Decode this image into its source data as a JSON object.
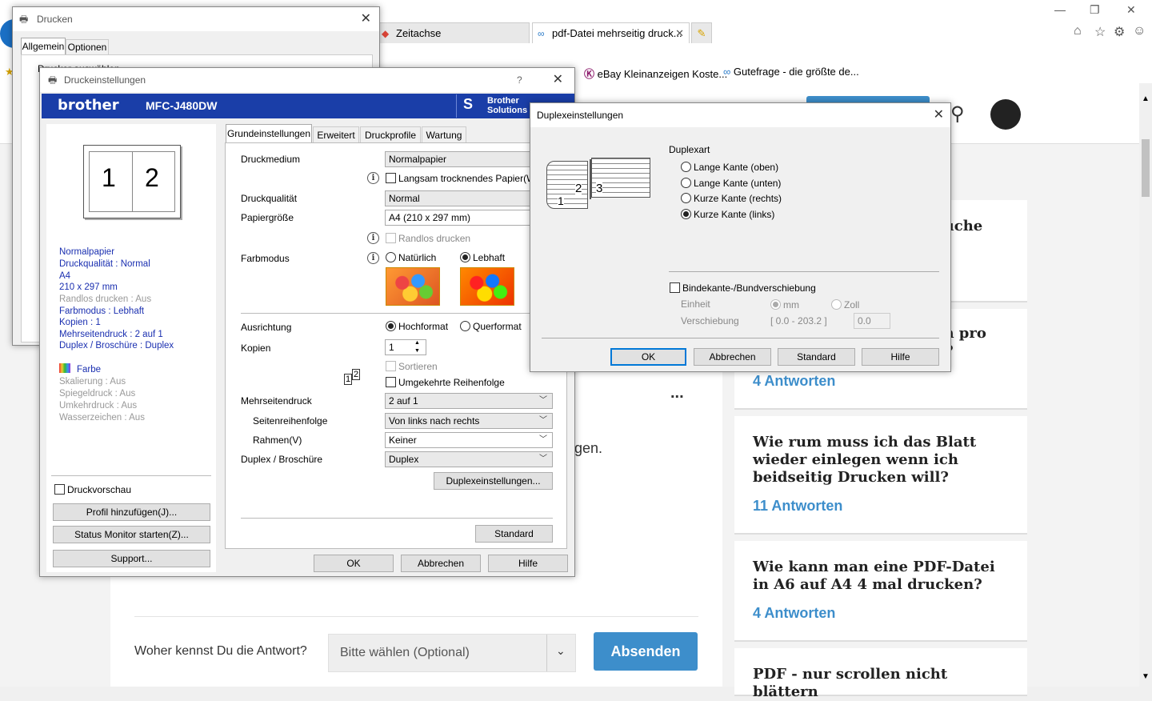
{
  "browser": {
    "tabs": [
      {
        "label": "Zeitachse"
      },
      {
        "label": "pdf-Datei mehrseitig druck..."
      }
    ],
    "window_controls": {
      "minimize": "—",
      "maximize": "❐",
      "close": "✕"
    },
    "favorites": [
      {
        "label": "eBay Kleinanzeigen  Koste..."
      },
      {
        "label": "Gutefrage - die größte de..."
      }
    ]
  },
  "site": {
    "main": {
      "partial_text": "gen.",
      "more": "...",
      "feedback_label": "Woher kennst Du die Antwort?",
      "select_placeholder": "Bitte wählen (Optional)",
      "submit_label": "Absenden"
    },
    "cards": [
      {
        "question": "auche",
        "answers": ""
      },
      {
        "question": "en pro\nn?",
        "answers": "4 Antworten"
      },
      {
        "question": "Wie rum muss ich das Blatt wieder einlegen wenn ich beidseitig Drucken will?",
        "answers": "11 Antworten"
      },
      {
        "question": "Wie kann man eine PDF-Datei in A6 auf A4 4 mal drucken?",
        "answers": "4 Antworten"
      },
      {
        "question": "PDF - nur scrollen nicht blättern",
        "answers": ""
      }
    ]
  },
  "print_dialog": {
    "title": "Drucken",
    "tabs": [
      "Allgemein",
      "Optionen"
    ],
    "partial_text": "Drucker auswählen"
  },
  "settings_dialog": {
    "title": "Druckeinstellungen",
    "help_glyph": "?",
    "brand": "brother",
    "model": "MFC-J480DW",
    "solutions": [
      "Brother",
      "Solutions"
    ],
    "preview_pages": [
      "1",
      "2"
    ],
    "summary": [
      "Normalpapier",
      "Druckqualität : Normal",
      "A4",
      "210 x 297 mm",
      "Randlos drucken : Aus",
      "Farbmodus : Lebhaft",
      "Kopien : 1",
      "Mehrseitendruck : 2 auf 1",
      "Duplex / Broschüre : Duplex"
    ],
    "summary2": [
      "Farbe",
      "Skalierung : Aus",
      "Spiegeldruck : Aus",
      "Umkehrdruck : Aus",
      "Wasserzeichen : Aus"
    ],
    "druckvorschau": "Druckvorschau",
    "btn_profil": "Profil hinzufügen(J)...",
    "btn_status": "Status Monitor starten(Z)...",
    "btn_support": "Support...",
    "tabs": [
      "Grundeinstellungen",
      "Erweitert",
      "Druckprofile",
      "Wartung"
    ],
    "labels": {
      "druckmedium": "Druckmedium",
      "druckqualitaet": "Druckqualität",
      "papiergroesse": "Papiergröße",
      "farbmodus": "Farbmodus",
      "ausrichtung": "Ausrichtung",
      "kopien": "Kopien",
      "mehrseitendruck": "Mehrseitendruck",
      "seitenreihenfolge": "Seitenreihenfolge",
      "rahmen": "Rahmen(V)",
      "duplex": "Duplex / Broschüre"
    },
    "values": {
      "druckmedium": "Normalpapier",
      "langsam": "Langsam trocknendes Papier(W)",
      "druckqualitaet": "Normal",
      "papiergroesse": "A4 (210 x 297 mm)",
      "randlos": "Randlos drucken",
      "natuerlich": "Natürlich",
      "lebhaft": "Lebhaft",
      "hochformat": "Hochformat",
      "querformat": "Querformat",
      "kopien": "1",
      "sortieren": "Sortieren",
      "umgekehrt": "Umgekehrte Reihenfolge",
      "mehrseitendruck": "2 auf 1",
      "seitenreihenfolge": "Von links nach rechts",
      "rahmen": "Keiner",
      "duplex": "Duplex"
    },
    "btn_duplexeinstellungen": "Duplexeinstellungen...",
    "btn_standard": "Standard",
    "btn_ok": "OK",
    "btn_abbrechen": "Abbrechen",
    "btn_hilfe": "Hilfe"
  },
  "duplex_dialog": {
    "title": "Duplexeinstellungen",
    "duplexart": "Duplexart",
    "options": [
      "Lange Kante (oben)",
      "Lange Kante (unten)",
      "Kurze Kante (rechts)",
      "Kurze Kante (links)"
    ],
    "selected_option": "Kurze Kante (links)",
    "illustration_pages": [
      "1",
      "2",
      "3"
    ],
    "bindekante": "Bindekante-/Bundverschiebung",
    "einheit": "Einheit",
    "mm": "mm",
    "zoll": "Zoll",
    "verschiebung": "Verschiebung",
    "range": "[ 0.0 - 203.2 ]",
    "value": "0.0",
    "btn_ok": "OK",
    "btn_abbrechen": "Abbrechen",
    "btn_standard": "Standard",
    "btn_hilfe": "Hilfe"
  }
}
